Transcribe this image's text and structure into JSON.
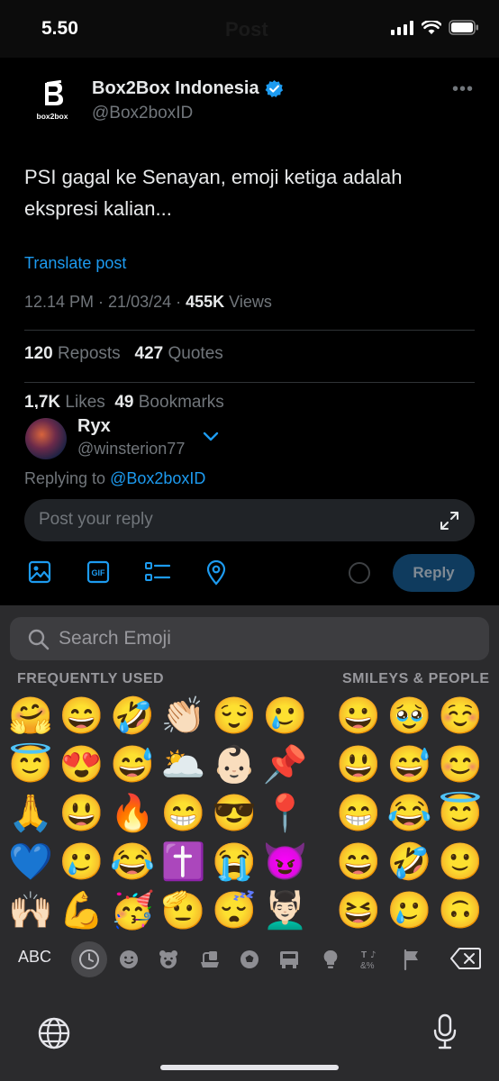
{
  "status_bar": {
    "time": "5.50",
    "ghost_title": "Post"
  },
  "tweet": {
    "display_name": "Box2Box Indonesia",
    "handle": "@Box2boxID",
    "logo_text": "box2box",
    "more": "•••",
    "text": "PSI gagal ke Senayan, emoji ketiga adalah ekspresi kalian...",
    "translate": "Translate post",
    "time": "12.14 PM · 21/03/24 · ",
    "views_count": "455K",
    "views_label": " Views",
    "reposts_count": "120",
    "reposts_label": " Reposts",
    "quotes_count": "427",
    "quotes_label": " Quotes",
    "likes_count": "1,7K",
    "likes_label": " Likes",
    "bookmarks_count": "49",
    "bookmarks_label": " Bookmarks"
  },
  "reply": {
    "name": "Ryx",
    "handle": "@winsterion77",
    "replying_prefix": "Replying to ",
    "replying_to": "@Box2boxID",
    "placeholder": "Post your reply",
    "button": "Reply"
  },
  "keyboard": {
    "search_placeholder": "Search Emoji",
    "frequently_used": "FREQUENTLY USED",
    "smileys_people": "SMILEYS & PEOPLE",
    "abc": "ABC",
    "frequent_rows": [
      [
        "🤗",
        "😄",
        "🤣",
        "👏🏻",
        "😌",
        "🥲"
      ],
      [
        "😇",
        "😍",
        "😅",
        "🌥️",
        "👶🏻",
        "📌"
      ],
      [
        "🙏",
        "😃",
        "🔥",
        "😁",
        "😎",
        "📍"
      ],
      [
        "💙",
        "🥲",
        "😂",
        "✝️",
        "😭",
        "😈"
      ],
      [
        "🙌🏻",
        "💪",
        "🥳",
        "🫡",
        "😴",
        "💆🏻‍♂️"
      ]
    ],
    "smiley_rows": [
      [
        "😀",
        "🥹",
        "☺️"
      ],
      [
        "😃",
        "😅",
        "😊"
      ],
      [
        "😁",
        "😂",
        "😇"
      ],
      [
        "😄",
        "🤣",
        "🙂"
      ],
      [
        "😆",
        "🥲",
        "🙃"
      ]
    ],
    "category_icons": [
      "clock-icon",
      "smiley-icon",
      "bear-icon",
      "food-icon",
      "ball-icon",
      "car-icon",
      "bulb-icon",
      "symbols-icon",
      "flag-icon"
    ]
  },
  "colors": {
    "accent": "#1d9bf0",
    "background": "#000000",
    "keyboard": "#2b2b2d"
  }
}
